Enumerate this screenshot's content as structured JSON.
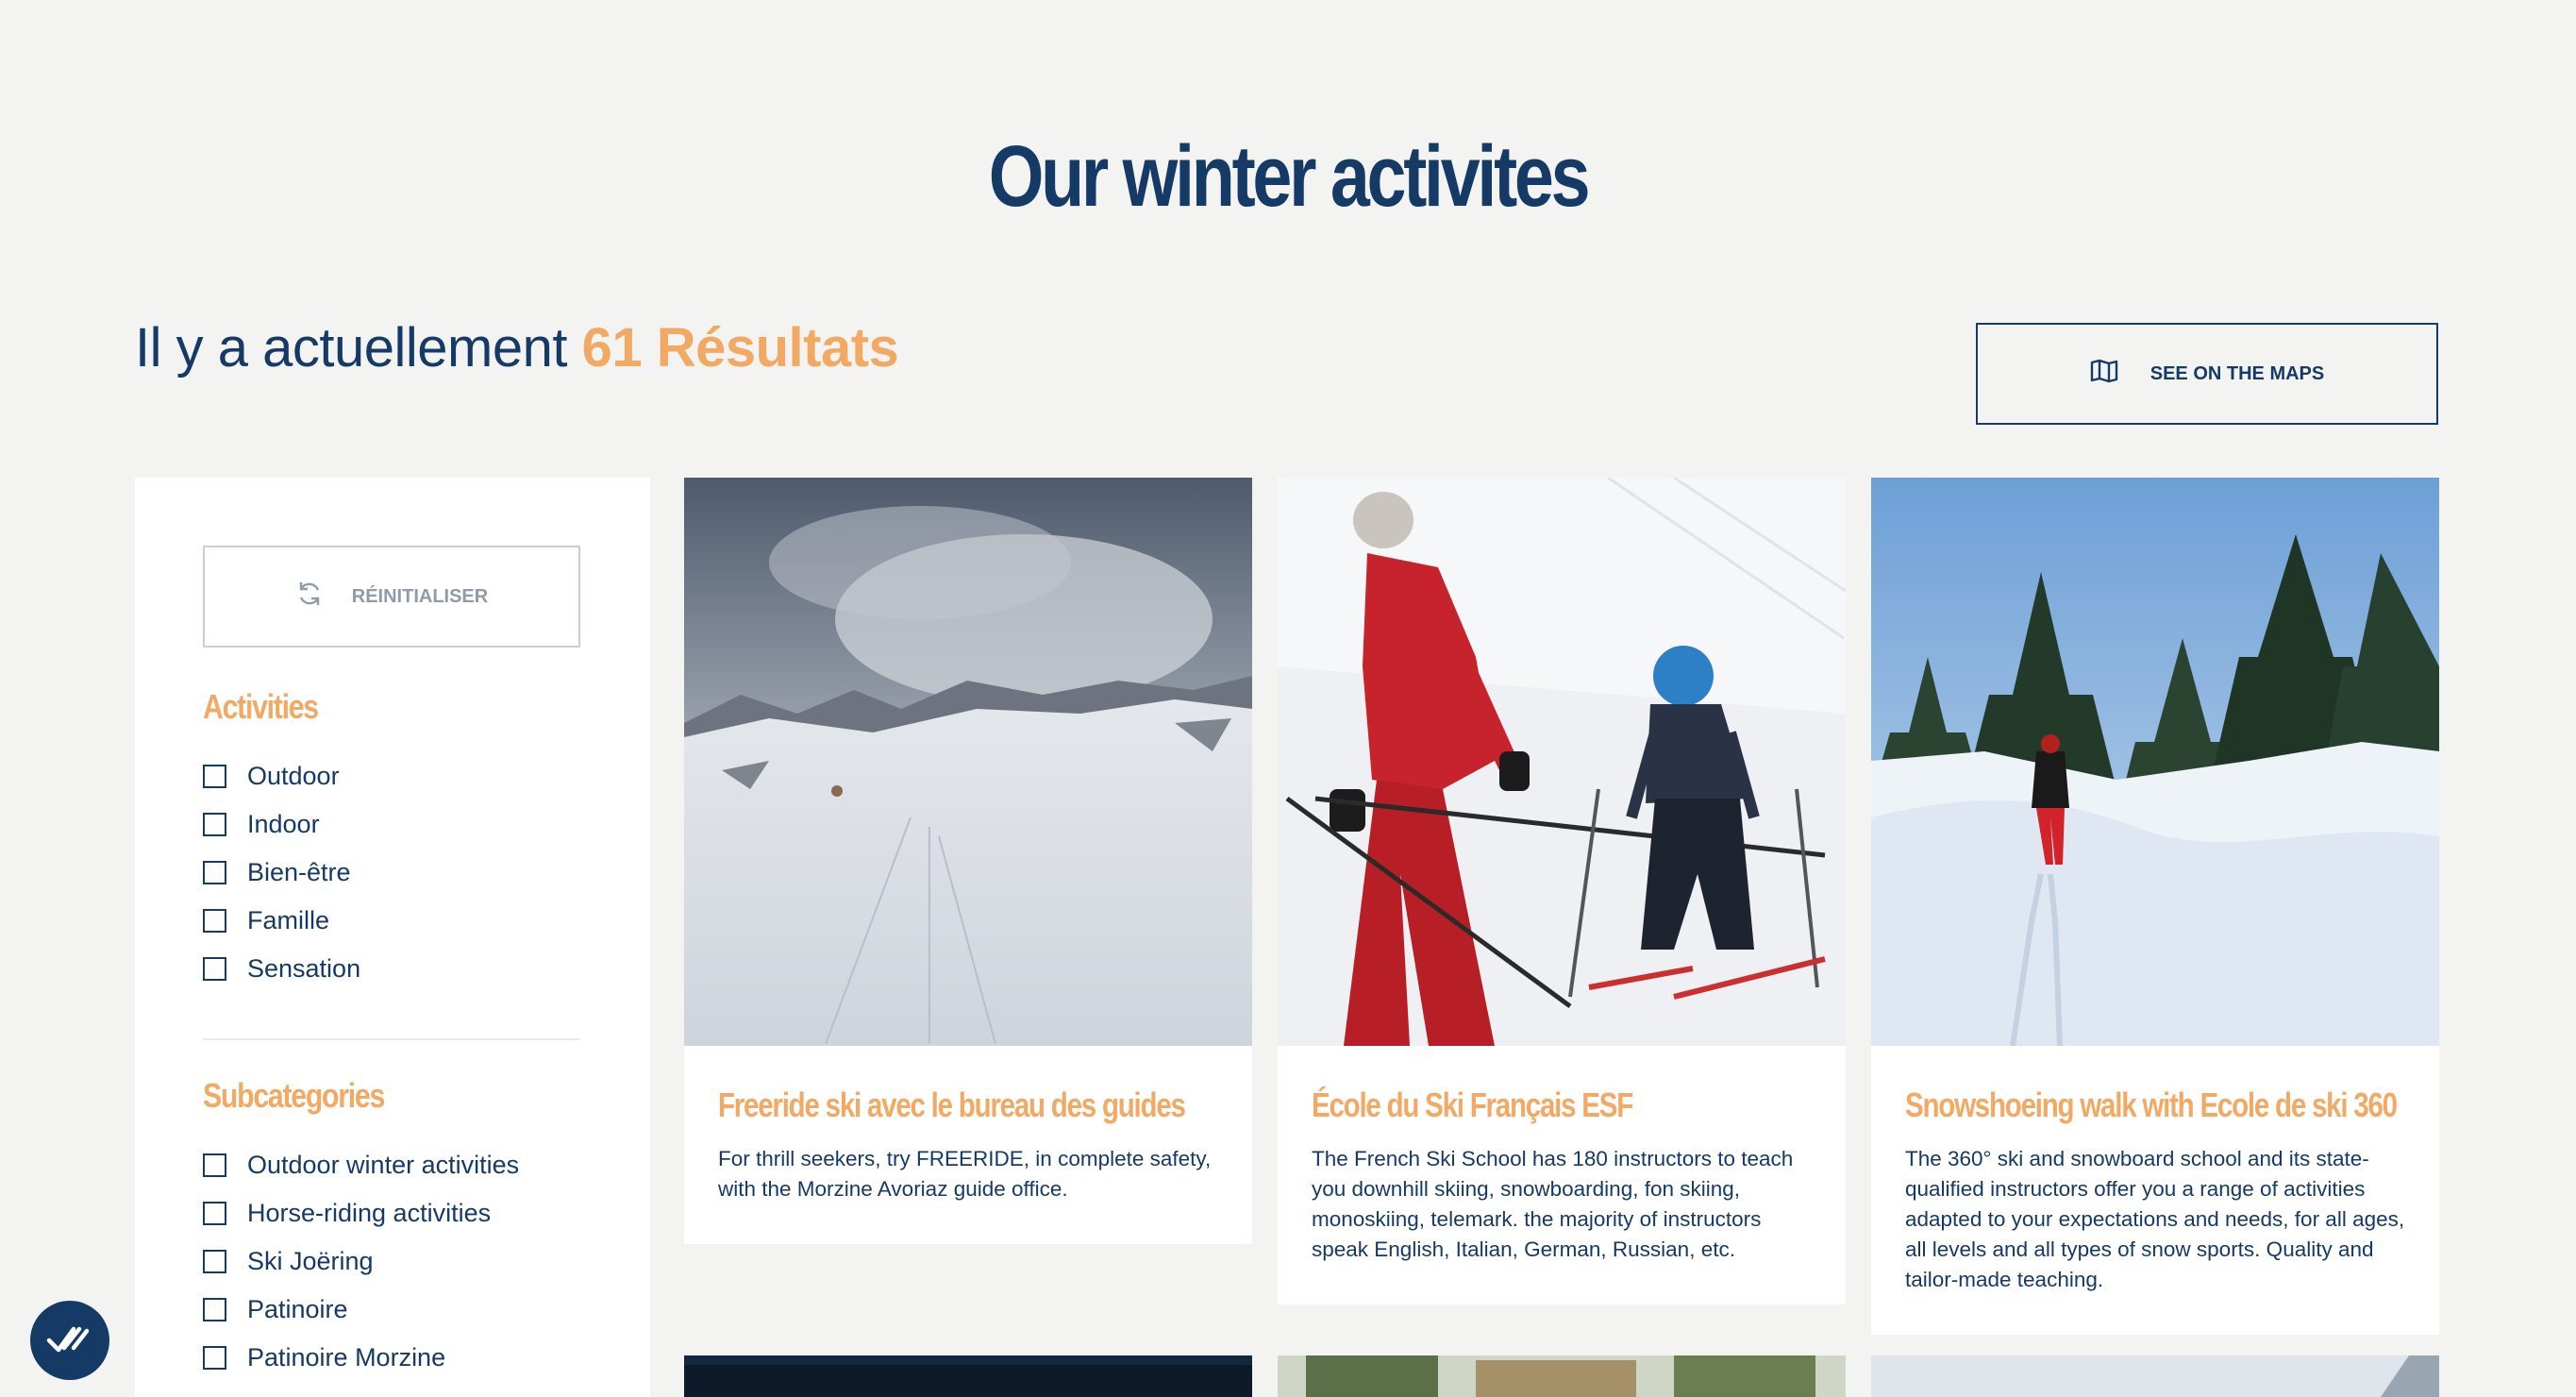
{
  "page": {
    "title": "Our winter activites"
  },
  "results": {
    "prefix": "Il y a actuellement",
    "count": "61 Résultats"
  },
  "map_button": {
    "label": "SEE ON THE MAPS",
    "icon": "map-icon"
  },
  "filters": {
    "reset_label": "RÉINITIALISER",
    "reset_icon": "refresh-icon",
    "activities": {
      "title": "Activities",
      "items": [
        "Outdoor",
        "Indoor",
        "Bien-être",
        "Famille",
        "Sensation"
      ]
    },
    "subcategories": {
      "title": "Subcategories",
      "items": [
        "Outdoor winter activities",
        "Horse-riding activities",
        "Ski Joëring",
        "Patinoire",
        "Patinoire Morzine"
      ]
    }
  },
  "cards": [
    {
      "title": "Freeride ski avec le bureau des guides",
      "description": "For thrill seekers, try FREERIDE, in complete safety, with the Morzine Avoriaz guide office."
    },
    {
      "title": "École du Ski Français ESF",
      "description": "The French Ski School has 180 instructors to teach you downhill skiing, snowboarding, fon skiing, monoskiing, telemark. the majority of instructors speak English, Italian, German, Russian, etc."
    },
    {
      "title": "Snowshoeing walk with Ecole de ski 360",
      "description": "The 360° ski and snowboard school and its state-qualified instructors offer you a range of activities adapted to your expectations and needs, for all ages, all levels and all types of snow sports. Quality and tailor-made teaching."
    }
  ],
  "chat": {
    "icon": "chat-check-icon"
  },
  "colors": {
    "navy": "#163a66",
    "accent": "#f2a964",
    "background": "#f3f3f2"
  }
}
